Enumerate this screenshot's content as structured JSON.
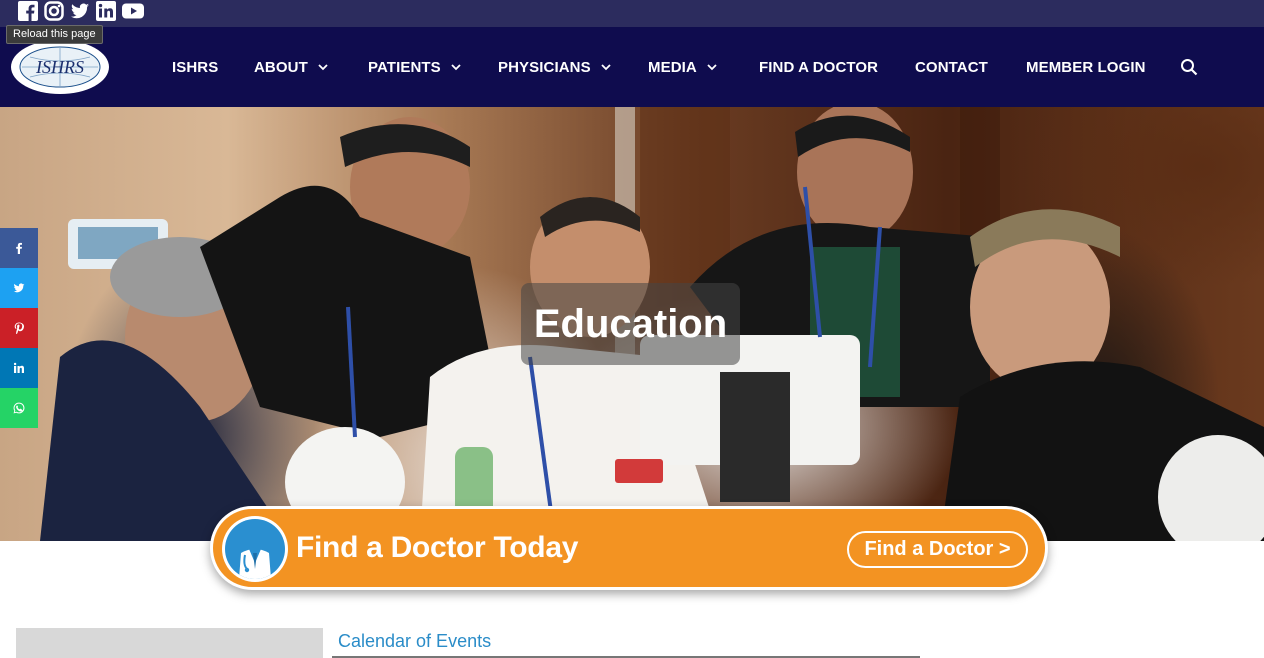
{
  "tooltip": {
    "text": "Reload this page"
  },
  "social_top": [
    {
      "icon": "facebook-icon"
    },
    {
      "icon": "instagram-icon"
    },
    {
      "icon": "twitter-icon"
    },
    {
      "icon": "linkedin-icon"
    },
    {
      "icon": "youtube-icon"
    }
  ],
  "nav": {
    "logo_text": "ISHRS",
    "items": [
      {
        "label": "ISHRS",
        "dropdown": false
      },
      {
        "label": "ABOUT",
        "dropdown": true
      },
      {
        "label": "PATIENTS",
        "dropdown": true
      },
      {
        "label": "PHYSICIANS",
        "dropdown": true
      },
      {
        "label": "MEDIA",
        "dropdown": true
      },
      {
        "label": "FIND A DOCTOR",
        "dropdown": false
      },
      {
        "label": "CONTACT",
        "dropdown": false
      },
      {
        "label": "MEMBER LOGIN",
        "dropdown": false
      }
    ],
    "search_icon": "search-icon"
  },
  "hero": {
    "title": "Education"
  },
  "share_bar": [
    {
      "icon": "facebook-icon",
      "color": "#3b5998"
    },
    {
      "icon": "twitter-icon",
      "color": "#1da1f2"
    },
    {
      "icon": "pinterest-icon",
      "color": "#cb2027"
    },
    {
      "icon": "linkedin-icon",
      "color": "#0077b5"
    },
    {
      "icon": "whatsapp-icon",
      "color": "#25d366"
    }
  ],
  "find_doctor_banner": {
    "title": "Find a Doctor Today",
    "button_label": "Find a Doctor >",
    "color": "#f39322"
  },
  "content": {
    "calendar_link": "Calendar of Events"
  },
  "colors": {
    "topbar": "#2c2c5e",
    "navbar": "#0f0c4e",
    "link": "#2a8cc8"
  }
}
